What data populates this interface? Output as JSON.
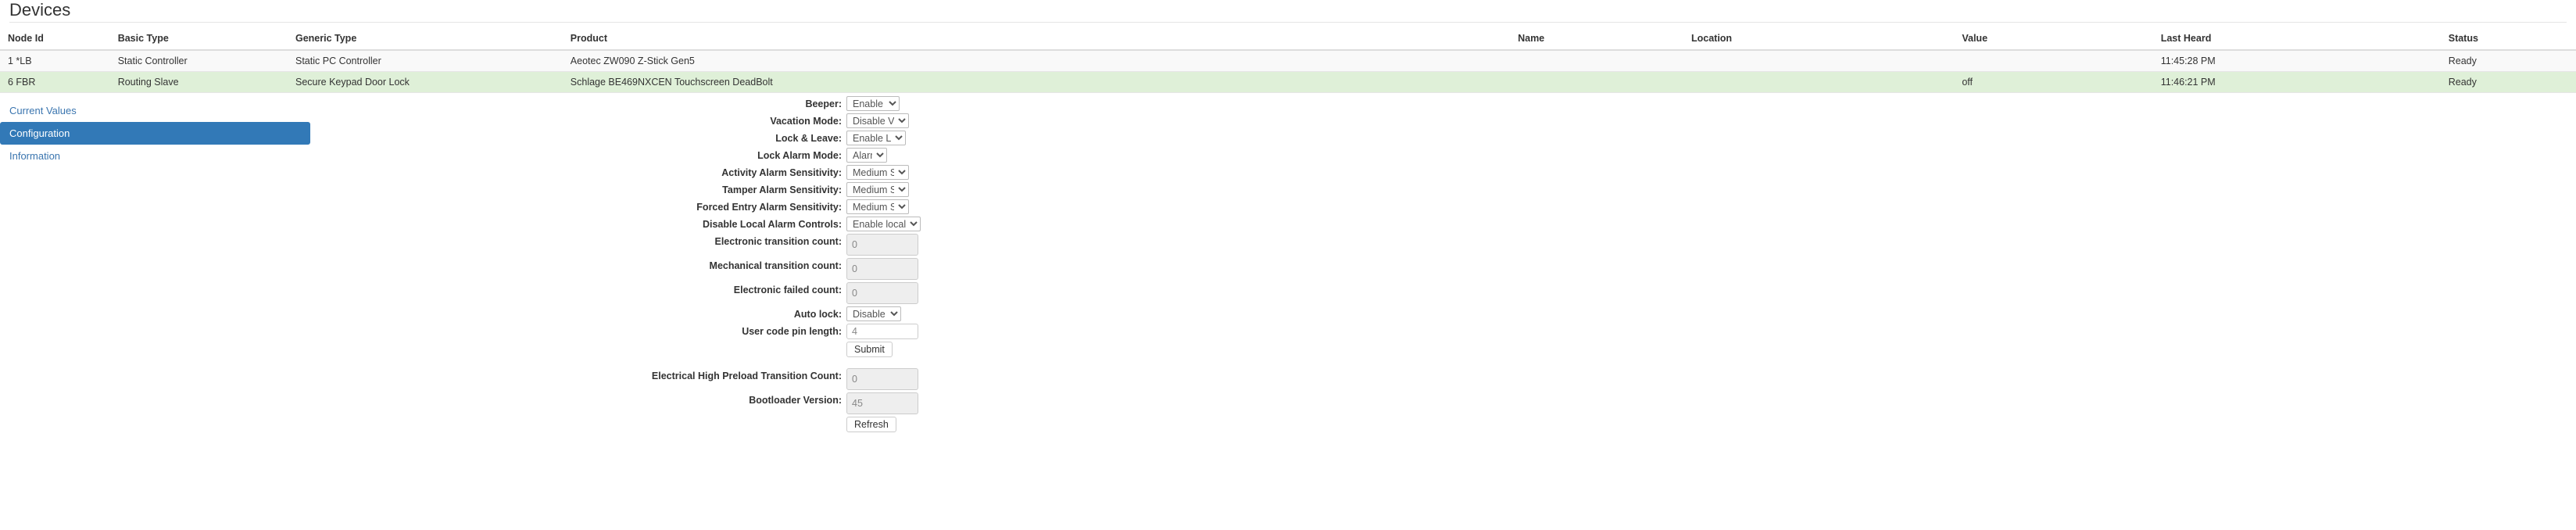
{
  "page": {
    "title": "Devices"
  },
  "devices_table": {
    "columns": [
      "Node Id",
      "Basic Type",
      "Generic Type",
      "Product",
      "Name",
      "Location",
      "Value",
      "Last Heard",
      "Status"
    ],
    "rows": [
      {
        "node_id": "1 *LB",
        "basic_type": "Static Controller",
        "generic_type": "Static PC Controller",
        "product": "Aeotec ZW090 Z-Stick Gen5",
        "name": "",
        "location": "",
        "value": "",
        "last_heard": "11:45:28 PM",
        "status": "Ready",
        "selected": false
      },
      {
        "node_id": "6 FBR",
        "basic_type": "Routing Slave",
        "generic_type": "Secure Keypad Door Lock",
        "product": "Schlage BE469NXCEN Touchscreen DeadBolt",
        "name": "",
        "location": "",
        "value": "off",
        "last_heard": "11:46:21 PM",
        "status": "Ready",
        "selected": true
      }
    ]
  },
  "nav": {
    "items": [
      {
        "label": "Current Values",
        "active": false
      },
      {
        "label": "Configuration",
        "active": true
      },
      {
        "label": "Information",
        "active": false
      }
    ],
    "active_color": "#3279b7",
    "link_color": "#3a75af"
  },
  "config": {
    "fields": [
      {
        "label": "Beeper:",
        "type": "select",
        "value": "Enable Beeper",
        "width": 68
      },
      {
        "label": "Vacation Mode:",
        "type": "select",
        "value": "Disable Vacation Mode",
        "width": 80
      },
      {
        "label": "Lock & Leave:",
        "type": "select",
        "value": "Enable Lock & Leave",
        "width": 76
      },
      {
        "label": "Lock Alarm Mode:",
        "type": "select",
        "value": "Alarm Off",
        "width": 52
      },
      {
        "label": "Activity Alarm Sensitivity:",
        "type": "select",
        "value": "Medium Sensitivity",
        "width": 80
      },
      {
        "label": "Tamper Alarm Sensitivity:",
        "type": "select",
        "value": "Medium Sensitivity",
        "width": 80
      },
      {
        "label": "Forced Entry Alarm Sensitivity:",
        "type": "select",
        "value": "Medium Sensitivity",
        "width": 80
      },
      {
        "label": "Disable Local Alarm Controls:",
        "type": "select",
        "value": "Enable local alarm controls",
        "width": 95
      },
      {
        "label": "Electronic transition count:",
        "type": "readonly",
        "value": "0"
      },
      {
        "label": "Mechanical transition count:",
        "type": "readonly",
        "value": "0"
      },
      {
        "label": "Electronic failed count:",
        "type": "readonly",
        "value": "0"
      },
      {
        "label": "Auto lock:",
        "type": "select",
        "value": "Disable auto lock",
        "width": 70
      },
      {
        "label": "User code pin length:",
        "type": "text",
        "value": "4"
      }
    ],
    "submit_label": "Submit",
    "extra_fields": [
      {
        "label": "Electrical High Preload Transition Count:",
        "type": "readonly",
        "value": "0"
      },
      {
        "label": "Bootloader Version:",
        "type": "readonly",
        "value": "45"
      }
    ],
    "refresh_label": "Refresh"
  }
}
